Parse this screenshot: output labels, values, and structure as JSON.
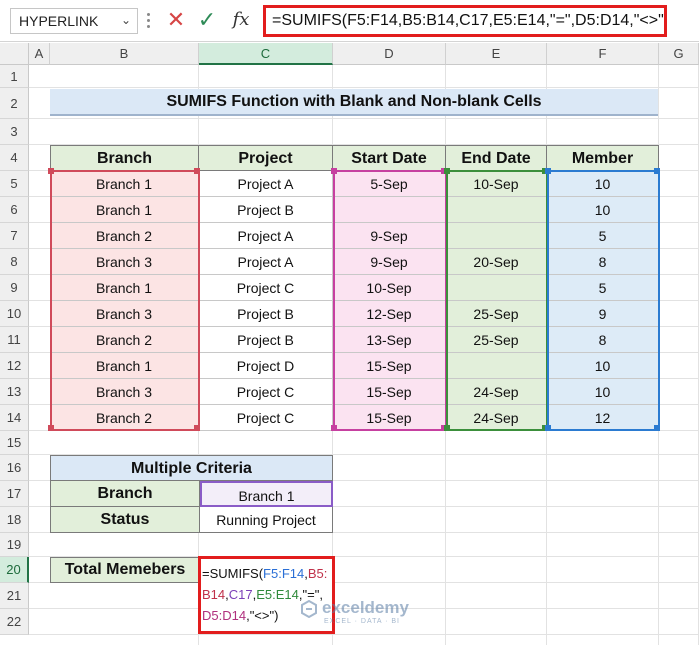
{
  "formula_bar": {
    "name_box": "HYPERLINK",
    "formula": "=SUMIFS(F5:F14,B5:B14,C17,E5:E14,\"=\",D5:D14,\"<>\")",
    "cancel_icon": "close-icon",
    "enter_icon": "check-icon",
    "fx_label": "fx"
  },
  "columns": [
    "A",
    "B",
    "C",
    "D",
    "E",
    "F",
    "G"
  ],
  "rows": [
    "1",
    "2",
    "3",
    "4",
    "5",
    "6",
    "7",
    "8",
    "9",
    "10",
    "11",
    "12",
    "13",
    "14",
    "15",
    "16",
    "17",
    "18",
    "19",
    "20",
    "21",
    "22"
  ],
  "title": "SUMIFS Function with Blank and Non-blank Cells",
  "table": {
    "headers": [
      "Branch",
      "Project",
      "Start Date",
      "End Date",
      "Member"
    ],
    "rows": [
      [
        "Branch 1",
        "Project A",
        "5-Sep",
        "10-Sep",
        "10"
      ],
      [
        "Branch 1",
        "Project B",
        "",
        "",
        "10"
      ],
      [
        "Branch 2",
        "Project A",
        "9-Sep",
        "",
        "5"
      ],
      [
        "Branch 3",
        "Project A",
        "9-Sep",
        "20-Sep",
        "8"
      ],
      [
        "Branch 1",
        "Project C",
        "10-Sep",
        "",
        "5"
      ],
      [
        "Branch 3",
        "Project B",
        "12-Sep",
        "25-Sep",
        "9"
      ],
      [
        "Branch 2",
        "Project B",
        "13-Sep",
        "25-Sep",
        "8"
      ],
      [
        "Branch 1",
        "Project D",
        "15-Sep",
        "",
        "10"
      ],
      [
        "Branch 3",
        "Project C",
        "15-Sep",
        "24-Sep",
        "10"
      ],
      [
        "Branch 2",
        "Project C",
        "15-Sep",
        "24-Sep",
        "12"
      ]
    ]
  },
  "criteria": {
    "title": "Multiple Criteria",
    "branch_label": "Branch",
    "branch_value": "Branch 1",
    "status_label": "Status",
    "status_value": "Running Project"
  },
  "total": {
    "label": "Total Memebers",
    "edit_parts": [
      {
        "t": "=SUMIFS(",
        "c": ""
      },
      {
        "t": "F5:F14",
        "c": "tF"
      },
      {
        "t": ",",
        "c": ""
      },
      {
        "t": "B5:",
        "c": "tB"
      },
      {
        "t": "\n",
        "c": ""
      },
      {
        "t": "B14",
        "c": "tB"
      },
      {
        "t": ",",
        "c": ""
      },
      {
        "t": "C17",
        "c": "tC"
      },
      {
        "t": ",",
        "c": ""
      },
      {
        "t": "E5:E14",
        "c": "tE"
      },
      {
        "t": ",\"=\",",
        "c": ""
      },
      {
        "t": "\n",
        "c": ""
      },
      {
        "t": "D5:D14",
        "c": "tD"
      },
      {
        "t": ",\"<>\")",
        "c": ""
      }
    ]
  },
  "watermark": {
    "name": "exceldemy",
    "tag": "EXCEL · DATA · BI"
  },
  "colors": {
    "branch_range": "#d04a5a",
    "project_range": "#8a5cc7",
    "start_range": "#c640a0",
    "end_range": "#3b8f3b",
    "member_range": "#2b7bd1",
    "crit_range": "#8a5cc7",
    "formula_border": "#e21d1d"
  }
}
